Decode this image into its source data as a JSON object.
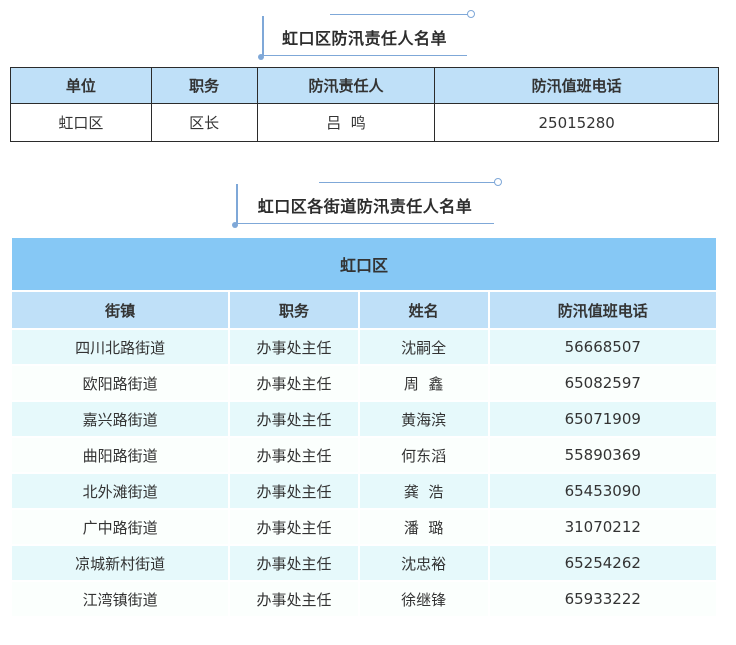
{
  "section1": {
    "title": "虹口区防汛责任人名单",
    "headers": [
      "单位",
      "职务",
      "防汛责任人",
      "防汛值班电话"
    ],
    "rows": [
      [
        "虹口区",
        "区长",
        "吕  鸣",
        "25015280"
      ]
    ]
  },
  "section2": {
    "title": "虹口区各街道防汛责任人名单",
    "district": "虹口区",
    "headers": [
      "街镇",
      "职务",
      "姓名",
      "防汛值班电话"
    ],
    "rows": [
      [
        "四川北路街道",
        "办事处主任",
        "沈嗣全",
        "56668507"
      ],
      [
        "欧阳路街道",
        "办事处主任",
        "周  鑫",
        "65082597"
      ],
      [
        "嘉兴路街道",
        "办事处主任",
        "黄海滨",
        "65071909"
      ],
      [
        "曲阳路街道",
        "办事处主任",
        "何东滔",
        "55890369"
      ],
      [
        "北外滩街道",
        "办事处主任",
        "龚  浩",
        "65453090"
      ],
      [
        "广中路街道",
        "办事处主任",
        "潘  璐",
        "31070212"
      ],
      [
        "凉城新村街道",
        "办事处主任",
        "沈忠裕",
        "65254262"
      ],
      [
        "江湾镇街道",
        "办事处主任",
        "徐继锋",
        "65933222"
      ]
    ]
  },
  "colors": {
    "header_blue": "#bfe0f8",
    "district_blue": "#86c8f5",
    "row_tint": "#e6f9fb",
    "accent_line": "#7fa8d8"
  }
}
